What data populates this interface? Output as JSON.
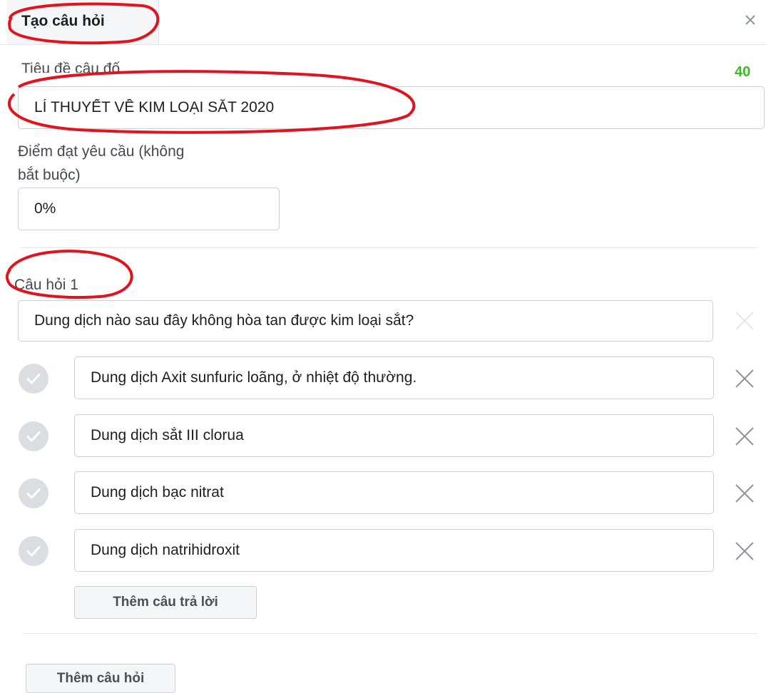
{
  "dialog": {
    "tab_title": "Tạo câu hỏi"
  },
  "quiz_title": {
    "label": "Tiêu đề câu đố",
    "remaining_chars": "40",
    "value": "LÍ THUYẾT VỀ KIM LOẠI SẮT 2020"
  },
  "passing_score": {
    "label_line1": "Điểm đạt yêu cầu (không",
    "label_line2": "bắt buộc)",
    "value": "0%"
  },
  "question": {
    "label": "Câu hỏi 1",
    "text": "Dung dịch nào sau đây không hòa tan được kim loại sắt?",
    "answers": [
      "Dung dịch Axit sunfuric loãng, ở nhiệt độ thường.",
      "Dung dịch sắt III clorua",
      "Dung dịch bạc nitrat",
      "Dung dịch natrihidroxit"
    ],
    "add_answer_label": "Thêm câu trả lời"
  },
  "add_question_label": "Thêm câu hỏi",
  "colors": {
    "annotation": "#e0141e",
    "counter": "#42b72a",
    "check_bg": "#dadde1"
  }
}
